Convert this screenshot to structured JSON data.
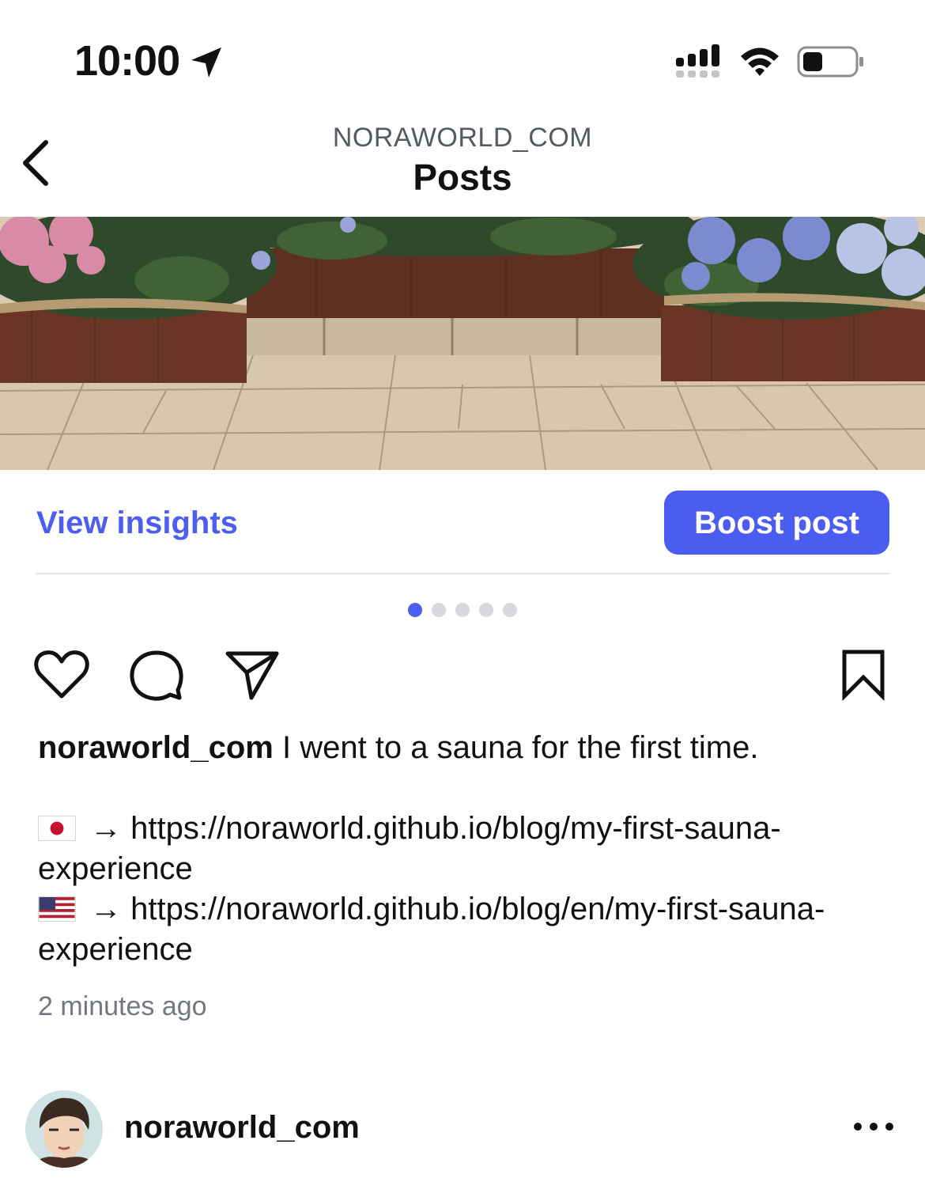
{
  "status_bar": {
    "time": "10:00",
    "icons": [
      "location-arrow-icon",
      "cellular-signal-icon",
      "wifi-icon",
      "battery-icon"
    ]
  },
  "header": {
    "account": "NORAWORLD_COM",
    "title": "Posts",
    "back_icon": "chevron-left-icon"
  },
  "post": {
    "insights_label": "View insights",
    "boost_label": "Boost post",
    "carousel": {
      "count": 5,
      "active_index": 0
    },
    "actions": [
      "heart-icon",
      "comment-icon",
      "share-icon",
      "bookmark-icon"
    ],
    "caption": {
      "username": "noraworld_com",
      "text": "I went to a sauna for the first time.",
      "links": [
        {
          "flag": "🇯🇵",
          "arrow": "→",
          "url": "https://noraworld.github.io/blog/my-first-sauna-experience"
        },
        {
          "flag": "🇺🇸",
          "arrow": "→",
          "url": "https://noraworld.github.io/blog/en/my-first-sauna-experience"
        }
      ]
    },
    "timestamp": "2 minutes ago"
  },
  "next_post": {
    "username": "noraworld_com",
    "more_icon": "more-horizontal-icon"
  },
  "colors": {
    "accent": "#4a5df0",
    "text": "#111111",
    "muted": "#737880",
    "dot_inactive": "#d6d8dc"
  }
}
